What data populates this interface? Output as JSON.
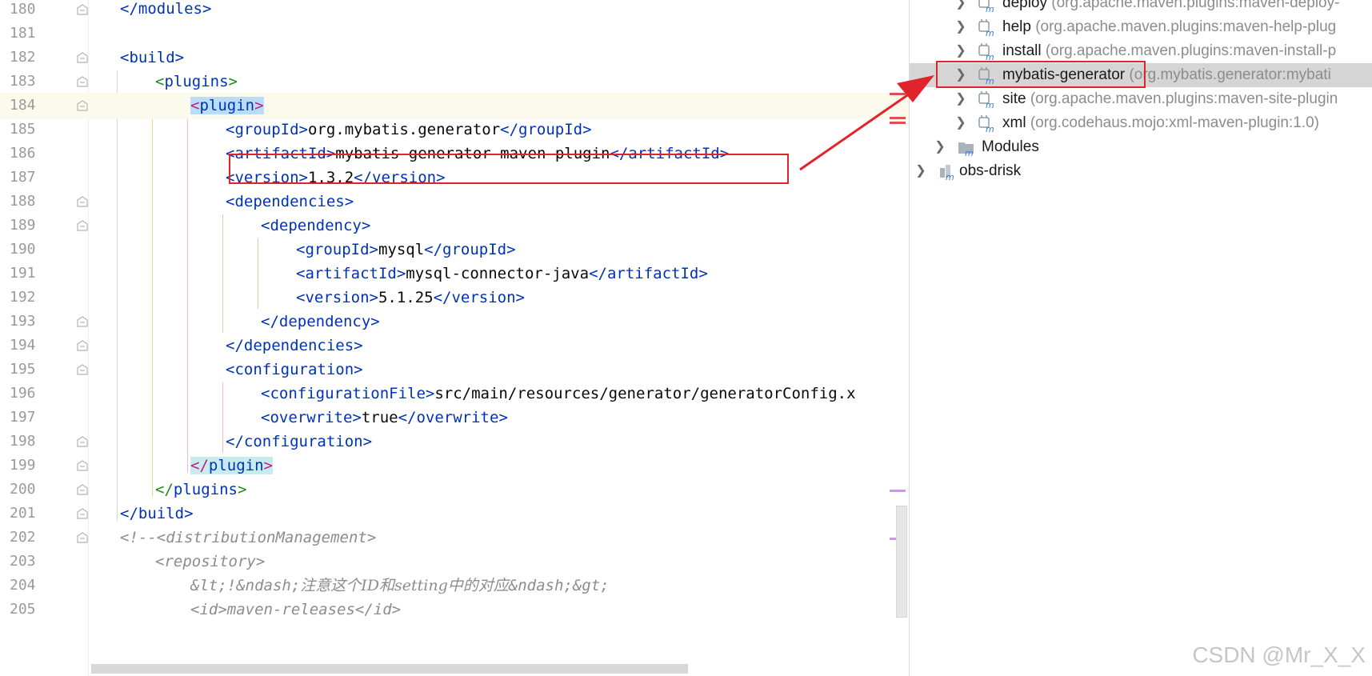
{
  "editor": {
    "line_numbers": [
      "180",
      "181",
      "182",
      "183",
      "184",
      "185",
      "186",
      "187",
      "188",
      "189",
      "190",
      "191",
      "192",
      "193",
      "194",
      "195",
      "196",
      "197",
      "198",
      "199",
      "200",
      "201",
      "202",
      "203",
      "204",
      "205"
    ],
    "code": {
      "l180": {
        "close_modules": "</modules>"
      },
      "l182": {
        "open_build": "<build>"
      },
      "l183": {
        "lt": "<",
        "name": "plugins",
        "gt": ">"
      },
      "l184": {
        "lt": "<",
        "name": "plugin",
        "gt": ">"
      },
      "l185": {
        "open": "<groupId>",
        "value": "org.mybatis.generator",
        "close": "</groupId>"
      },
      "l186": {
        "open": "<artifactId>",
        "value": "mybatis-generator-maven-plugin",
        "close": "</artifactId>"
      },
      "l187": {
        "open": "<version>",
        "value": "1.3.2",
        "close": "</version>"
      },
      "l188": {
        "open": "<dependencies>"
      },
      "l189": {
        "open": "<dependency>"
      },
      "l190": {
        "open": "<groupId>",
        "value": "mysql",
        "close": "</groupId>"
      },
      "l191": {
        "open": "<artifactId>",
        "value": "mysql-connector-java",
        "close": "</artifactId>"
      },
      "l192": {
        "open": "<version>",
        "value": "5.1.25",
        "close": "</version>"
      },
      "l193": {
        "close": "</dependency>"
      },
      "l194": {
        "close": "</dependencies>"
      },
      "l195": {
        "open": "<configuration>"
      },
      "l196": {
        "open": "<configurationFile>",
        "value": "src/main/resources/generator/generatorConfig.x"
      },
      "l197": {
        "open": "<overwrite>",
        "value": "true",
        "close": "</overwrite>"
      },
      "l198": {
        "close": "</configuration>"
      },
      "l199": {
        "lt": "</",
        "name": "plugin",
        "gt": ">"
      },
      "l200": {
        "lt": "</",
        "name": "plugins",
        "gt": ">"
      },
      "l201": {
        "close_build": "</build>"
      },
      "l202": {
        "comment": "<!--<distributionManagement>"
      },
      "l203": {
        "comment": "<repository>"
      },
      "l204": {
        "comment_a": "&lt;!&ndash;",
        "comment_cjk": "注意这个ID和setting中的对应",
        "comment_b": "&ndash;&gt;"
      },
      "l205": {
        "comment": "<id>maven-releases</id>"
      }
    }
  },
  "maven_panel": {
    "items": [
      {
        "name": "deploy",
        "coord": "(org.apache.maven.plugins:maven-deploy-"
      },
      {
        "name": "help",
        "coord": "(org.apache.maven.plugins:maven-help-plug"
      },
      {
        "name": "install",
        "coord": "(org.apache.maven.plugins:maven-install-p"
      },
      {
        "name": "mybatis-generator",
        "coord": "(org.mybatis.generator:mybati"
      },
      {
        "name": "site",
        "coord": "(org.apache.maven.plugins:maven-site-plugin"
      },
      {
        "name": "xml",
        "coord": "(org.codehaus.mojo:xml-maven-plugin:1.0)"
      }
    ],
    "modules_label": "Modules",
    "project_label": "obs-drisk"
  },
  "watermark": "CSDN @Mr_X_X",
  "colors": {
    "annotation_red": "#e0242c",
    "tag_blue": "#0033b3",
    "bracket_green": "#1a8c1a",
    "comment_gray": "#8c8c8c"
  }
}
